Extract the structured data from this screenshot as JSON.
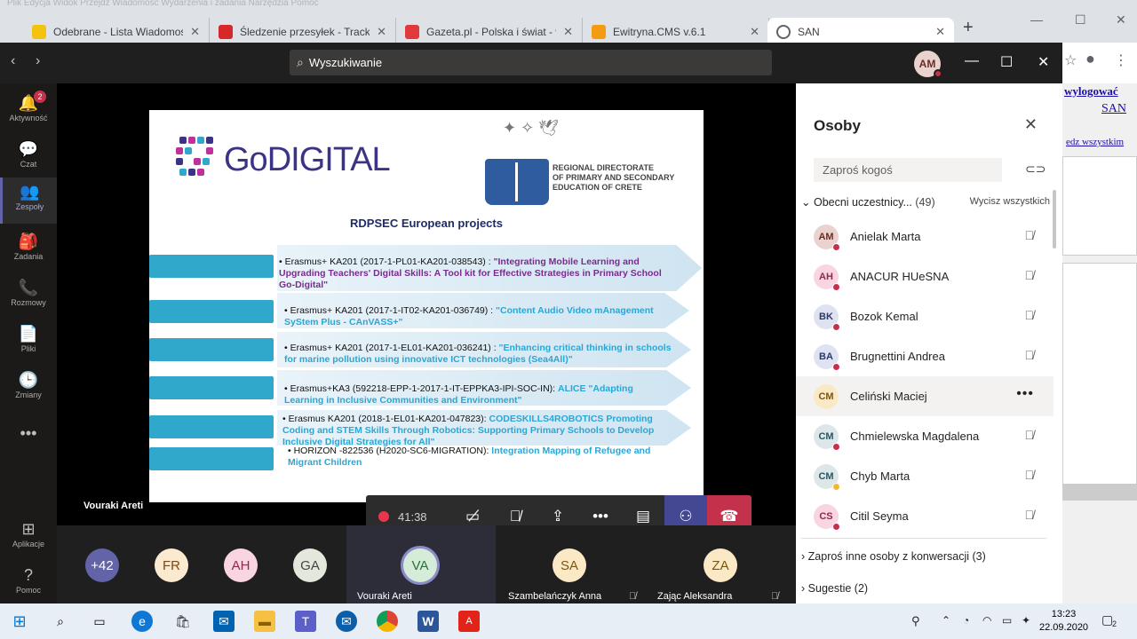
{
  "browser": {
    "menu_ghost": "Plik  Edycja  Widok  Przejdź  Wiadomość  Wydarzenia i zadania  Narzędzia  Pomoc",
    "tabs": [
      {
        "title": "Odebrane - Lista Wiadomości",
        "icon": "mail-icon",
        "color": "#f2c40f"
      },
      {
        "title": "Śledzenie przesyłek - Tracking",
        "icon": "tracking-icon",
        "color": "#d62828"
      },
      {
        "title": "Gazeta.pl - Polska i świat - wia",
        "icon": "gazeta-icon",
        "color": "#e03a3a"
      },
      {
        "title": "Ewitryna.CMS v.6.1",
        "icon": "cms-icon",
        "color": "#f39c12"
      },
      {
        "title": "SAN",
        "icon": "globe-icon",
        "color": "#5f6368"
      }
    ],
    "new_tab": "+"
  },
  "teams": {
    "search_placeholder": "Wyszukiwanie",
    "user_initials": "AM",
    "rail": [
      {
        "label": "Aktywność",
        "icon": "bell-icon",
        "glyph": "🔔",
        "badge": "2"
      },
      {
        "label": "Czat",
        "icon": "chat-icon",
        "glyph": "💬"
      },
      {
        "label": "Zespoły",
        "icon": "teams-icon",
        "glyph": "👥"
      },
      {
        "label": "Zadania",
        "icon": "assignments-icon",
        "glyph": "🎒"
      },
      {
        "label": "Rozmowy",
        "icon": "phone-icon",
        "glyph": "📞"
      },
      {
        "label": "Pliki",
        "icon": "files-icon",
        "glyph": "📄"
      },
      {
        "label": "Zmiany",
        "icon": "shifts-icon",
        "glyph": "🕒"
      },
      {
        "label": "...",
        "icon": "more-icon",
        "glyph": "•••"
      },
      {
        "label": "Aplikacje",
        "icon": "apps-icon",
        "glyph": "⊞"
      },
      {
        "label": "Pomoc",
        "icon": "help-icon",
        "glyph": "?"
      }
    ],
    "slide": {
      "logo_prefix": "Go",
      "logo_main": "DIGITAL",
      "crete_lines": [
        "REGIONAL DIRECTORATE",
        "OF PRIMARY AND SECONDARY",
        "EDUCATION OF CRETE"
      ],
      "title": "RDPSEC European projects",
      "projects": [
        {
          "code": "• Erasmus+ KA201 (2017-1-PL01-KA201-038543) : ",
          "name": "\"Integrating Mobile Learning and Upgrading Teachers' Digital Skills: A Tool kit for Effective Strategies in Primary School Go-Digital\"",
          "style": "t1"
        },
        {
          "code": "• Erasmus+ KA201 (2017-1-IT02-KA201-036749) : ",
          "name": "\"Content Audio Video mAnagement SyStem Plus - CAnVASS+\"",
          "style": "t2"
        },
        {
          "code": "• Erasmus+ KA201 (2017-1-EL01-KA201-036241) : ",
          "name": "\"Enhancing critical thinking in schools for marine pollution using innovative ICT technologies (Sea4All)\"",
          "style": "t2"
        },
        {
          "code": "• Erasmus+KA3 (592218-EPP-1-2017-1-IT-EPPKA3-IPI-SOC-IN): ",
          "name": "ALICE \"Adapting Learning in Inclusive Communities and Environment\"",
          "style": "t2"
        },
        {
          "code": "• Erasmus KA201 (2018-1-EL01-KA201-047823): ",
          "name": "CODESKILLS4ROBOTICS Promoting Coding and STEM Skills Through Robotics: Supporting Primary Schools to Develop Inclusive Digital Strategies for All\"",
          "style": "t2"
        },
        {
          "code": "• HORIZON -822536 (H2020-SC6-MIGRATION): ",
          "name": "Integration Mapping of Refugee and Migrant Children",
          "style": "t2"
        }
      ]
    },
    "speaker_name": "Vouraki Areti",
    "call": {
      "timer": "41:38"
    },
    "strip": [
      {
        "initials": "+42",
        "bg": "#6264a7",
        "fg": "#ffffff"
      },
      {
        "initials": "FR",
        "bg": "#fbe9d0",
        "fg": "#7a4a12"
      },
      {
        "initials": "AH",
        "bg": "#f8d5e0",
        "fg": "#8a2c4a"
      },
      {
        "initials": "GA",
        "bg": "#e3e7dc",
        "fg": "#444"
      }
    ],
    "tiles": [
      {
        "initials": "VA",
        "name": "Vouraki Areti",
        "bg": "#d5ecd9",
        "fg": "#2f6b3a"
      },
      {
        "initials": "SA",
        "name": "Szambelańczyk Anna",
        "bg": "#fbe9c6",
        "fg": "#7a5512"
      },
      {
        "initials": "ZA",
        "name": "Zając Aleksandra",
        "bg": "#fbe9c6",
        "fg": "#7a5512"
      }
    ],
    "panel": {
      "title": "Osoby",
      "invite_placeholder": "Zaproś kogoś",
      "section_label": "Obecni uczestnicy...",
      "section_count": "(49)",
      "mute_all": "Wycisz wszystkich",
      "people": [
        {
          "initials": "AM",
          "name": "Anielak Marta",
          "bg": "#ead3cf",
          "fg": "#6b2b24",
          "status": "#c4314b"
        },
        {
          "initials": "AH",
          "name": "ANACUR HUeSNA",
          "bg": "#f8d5e0",
          "fg": "#8a2c4a",
          "status": "#c4314b"
        },
        {
          "initials": "BK",
          "name": "Bozok Kemal",
          "bg": "#dfe3f1",
          "fg": "#2b3a6b",
          "status": "#c4314b"
        },
        {
          "initials": "BA",
          "name": "Brugnettini Andrea",
          "bg": "#dfe3f1",
          "fg": "#2b3a6b",
          "status": "#c4314b"
        },
        {
          "initials": "CM",
          "name": "Celiński Maciej",
          "bg": "#fbe9c6",
          "fg": "#7a5512",
          "status": "#c4314b"
        },
        {
          "initials": "CM",
          "name": "Chmielewska Magdalena",
          "bg": "#dde7e9",
          "fg": "#2b5560",
          "status": "#c4314b"
        },
        {
          "initials": "CM",
          "name": "Chyb Marta",
          "bg": "#dde7e9",
          "fg": "#2b5560",
          "status": "#f8b62d"
        },
        {
          "initials": "CS",
          "name": "Citil Seyma",
          "bg": "#f8d5e0",
          "fg": "#8a2c4a",
          "status": "#c4314b"
        }
      ],
      "more_section": "Zaproś inne osoby z konwersacji",
      "more_count": "(3)",
      "suggest_section": "Sugestie",
      "suggest_count": "(2)"
    }
  },
  "bg_page": {
    "logout": "wylogować",
    "san": "SAN",
    "see_all": "edz wszystkim"
  },
  "taskbar": {
    "time": "13:23",
    "date": "22.09.2020",
    "notif": "2"
  }
}
